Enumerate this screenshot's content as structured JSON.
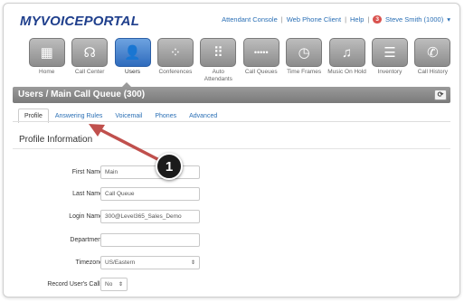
{
  "brand": {
    "logo": "MYVOICEPORTAL"
  },
  "topnav": {
    "attendant_console": "Attendant Console",
    "sep1": "|",
    "web_phone_client": "Web Phone Client",
    "sep2": "|",
    "help": "Help",
    "sep3": "|",
    "badge_count": "3",
    "user": "Steve Smith (1000)",
    "user_caret": "▾"
  },
  "nav": {
    "items": [
      {
        "label": "Home",
        "icon": "building-icon",
        "glyph": "▦"
      },
      {
        "label": "Call Center",
        "icon": "headset-icon",
        "glyph": "☊"
      },
      {
        "label": "Users",
        "icon": "user-icon",
        "glyph": "👤"
      },
      {
        "label": "Conferences",
        "icon": "conference-icon",
        "glyph": "⁘"
      },
      {
        "label": "Auto Attendants",
        "icon": "keypad-icon",
        "glyph": "⠿"
      },
      {
        "label": "Call Queues",
        "icon": "queue-icon",
        "glyph": "•••••"
      },
      {
        "label": "Time Frames",
        "icon": "clock-icon",
        "glyph": "◷"
      },
      {
        "label": "Music On Hold",
        "icon": "music-icon",
        "glyph": "♫"
      },
      {
        "label": "Inventory",
        "icon": "list-icon",
        "glyph": "☰"
      },
      {
        "label": "Call History",
        "icon": "phone-history-icon",
        "glyph": "✆"
      }
    ],
    "active": "Users"
  },
  "titlebar": {
    "title": "Users  /  Main Call Queue (300)",
    "refresh_glyph": "⟳"
  },
  "tabs": [
    "Profile",
    "Answering Rules",
    "Voicemail",
    "Phones",
    "Advanced"
  ],
  "active_tab": "Profile",
  "section": {
    "title": "Profile Information"
  },
  "form": {
    "first_name": {
      "label": "First Name",
      "value": "Main"
    },
    "last_name": {
      "label": "Last Name",
      "value": "Call Queue"
    },
    "login_name": {
      "label": "Login Name",
      "value": "300@Level365_Sales_Demo"
    },
    "department": {
      "label": "Department",
      "value": ""
    },
    "timezone": {
      "label": "Timezone",
      "value": "US/Eastern"
    },
    "record_calls": {
      "label": "Record User's Calls",
      "value": "No"
    }
  },
  "callout": {
    "number": "1"
  },
  "colors": {
    "accent": "#2f6bbd",
    "link": "#2a6fb5",
    "arrow": "#c0504d",
    "logo": "#1f3f8c"
  }
}
